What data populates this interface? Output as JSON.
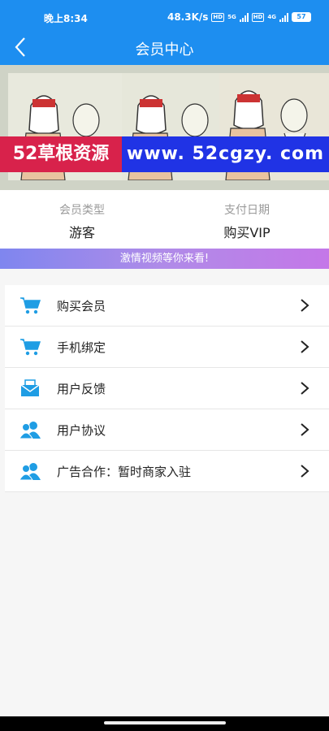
{
  "status_bar": {
    "time": "晚上8:34",
    "speed": "48.3K/s",
    "net1": "5G",
    "net2": "4G",
    "battery": "57"
  },
  "header": {
    "title": "会员中心"
  },
  "banner": {
    "watermark_left": "52草根资源",
    "watermark_right": "www. 52cgzy. com"
  },
  "info": {
    "member_type_label": "会员类型",
    "member_type_value": "游客",
    "pay_date_label": "支付日期",
    "pay_date_value": "购买VIP"
  },
  "marquee": "激情视频等你来看!",
  "menu": {
    "items": [
      {
        "label": "购买会员",
        "icon": "cart-icon"
      },
      {
        "label": "手机绑定",
        "icon": "cart-icon"
      },
      {
        "label": "用户反馈",
        "icon": "mail-icon"
      },
      {
        "label": "用户协议",
        "icon": "users-icon"
      },
      {
        "label": "广告合作：暂时商家入驻",
        "icon": "users-icon"
      }
    ]
  },
  "colors": {
    "primary": "#1d8ef0",
    "icon": "#1f9de4",
    "marquee_start": "#7f86ef",
    "marquee_end": "#c477e8"
  }
}
